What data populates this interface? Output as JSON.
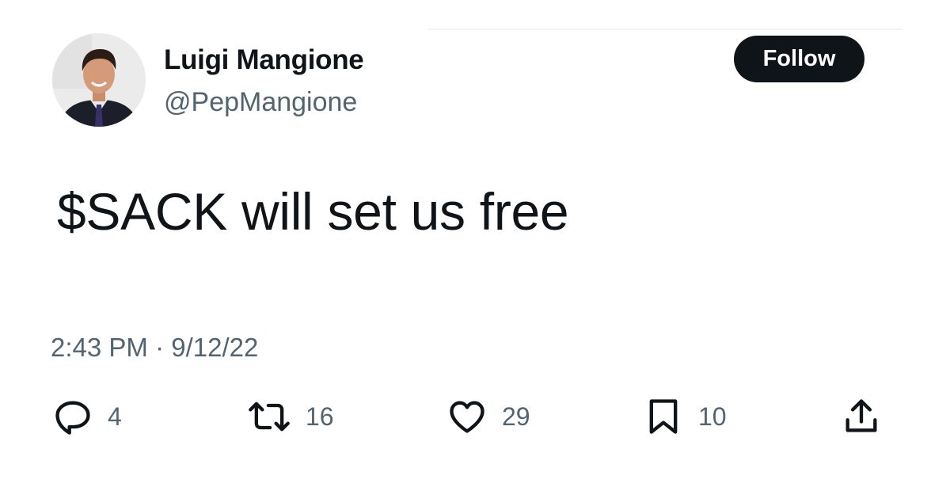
{
  "author": {
    "display_name": "Luigi Mangione",
    "handle": "@PepMangione",
    "avatar": "profile-photo"
  },
  "follow_button": {
    "label": "Follow"
  },
  "tweet": {
    "text": "$SACK will set us free",
    "timestamp": "2:43 PM · 9/12/22"
  },
  "actions": {
    "replies": {
      "icon": "reply-icon",
      "count": "4"
    },
    "retweets": {
      "icon": "retweet-icon",
      "count": "16"
    },
    "likes": {
      "icon": "heart-icon",
      "count": "29"
    },
    "bookmarks": {
      "icon": "bookmark-icon",
      "count": "10"
    },
    "share": {
      "icon": "share-icon"
    }
  },
  "colors": {
    "text_primary": "#0f1419",
    "text_secondary": "#536471",
    "follow_button_bg": "#0f1419",
    "follow_button_text": "#ffffff",
    "background": "#ffffff"
  }
}
